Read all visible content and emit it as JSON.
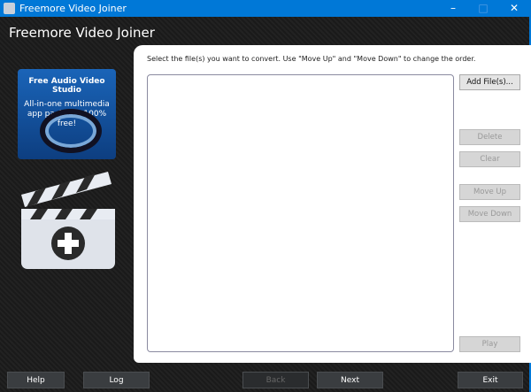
{
  "window": {
    "title": "Freemore Video Joiner",
    "minimize": "–",
    "maximize": "□",
    "close": "✕"
  },
  "header": {
    "title": "Freemore Video Joiner"
  },
  "ad": {
    "heading": "Free Audio Video Studio",
    "text": "All-in-one multimedia app package, 100% free!"
  },
  "main": {
    "instruction": "Select the file(s) you want to convert. Use \"Move Up\" and \"Move Down\" to change the order.",
    "buttons": {
      "add": "Add File(s)...",
      "delete": "Delete",
      "clear": "Clear",
      "move_up": "Move Up",
      "move_down": "Move Down",
      "play": "Play"
    }
  },
  "footer": {
    "help": "Help",
    "log": "Log",
    "back": "Back",
    "next": "Next",
    "exit": "Exit"
  },
  "colors": {
    "titlebar": "#0078d7"
  }
}
